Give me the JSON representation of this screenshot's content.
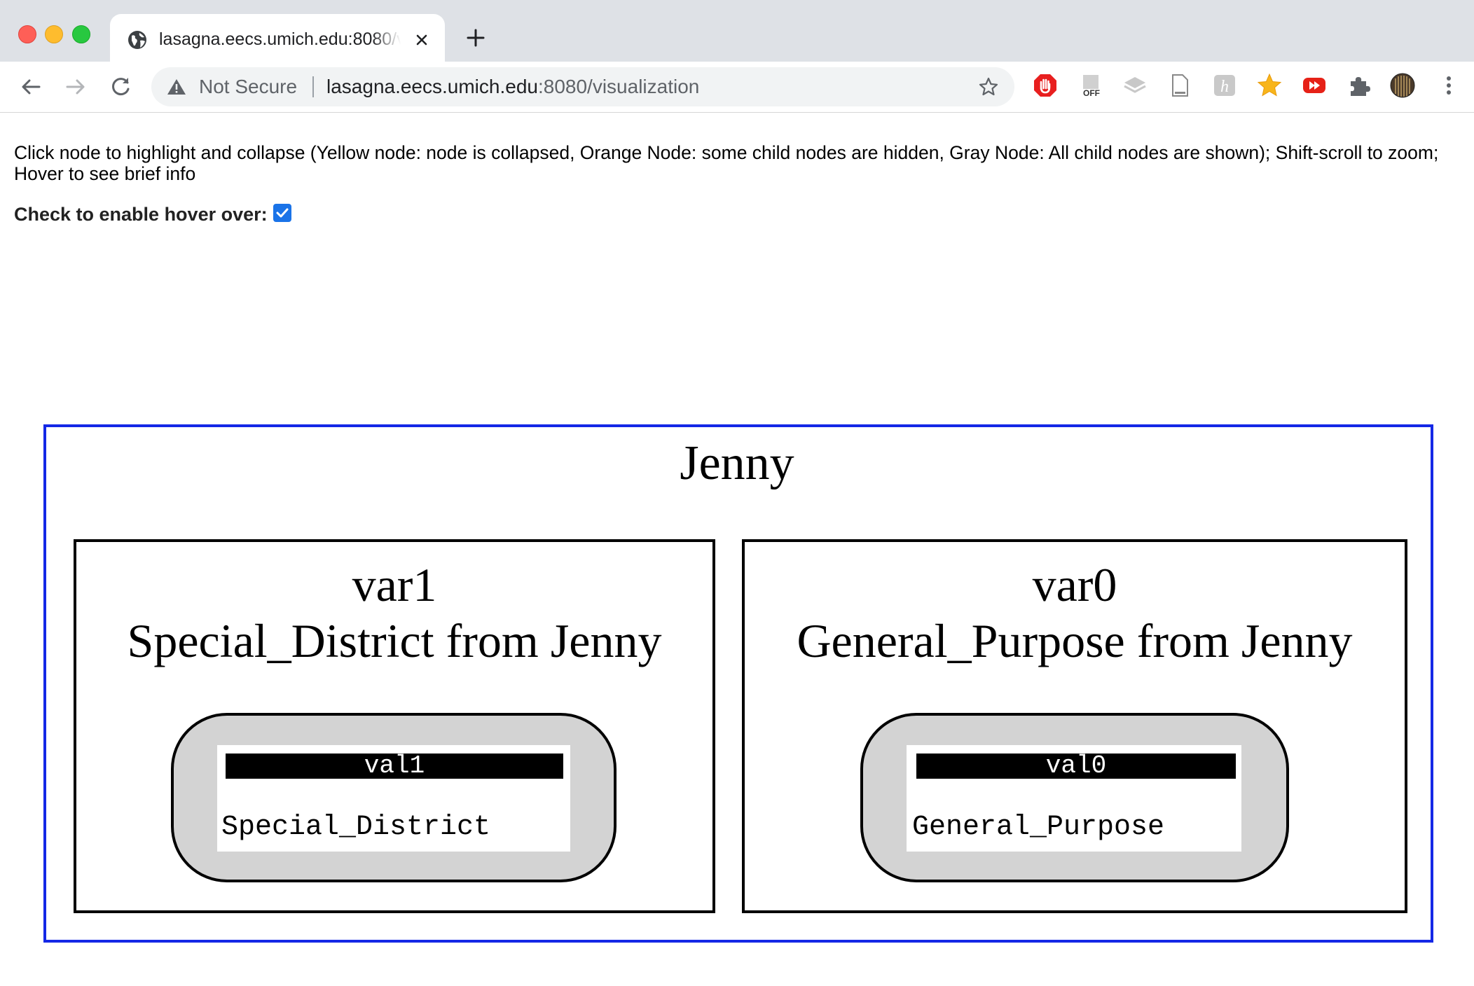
{
  "browser": {
    "tab_title": "lasagna.eecs.umich.edu:8080/visualization",
    "security_label": "Not Secure",
    "url_host": "lasagna.eecs.umich.edu",
    "url_rest": ":8080/visualization",
    "extensions": [
      "adblock-icon",
      "off-toggle-icon",
      "layers-icon",
      "document-icon",
      "h-extension-icon",
      "star-extension-icon",
      "youtube-icon",
      "puzzle-icon",
      "profile-avatar"
    ]
  },
  "page": {
    "instructions": "Click node to highlight and collapse (Yellow node: node is collapsed, Orange Node: some child nodes are hidden, Gray Node: All child nodes are shown); Shift-scroll to zoom; Hover to see brief info",
    "hover_label": "Check to enable hover over:",
    "hover_checked": true
  },
  "graph": {
    "root": "Jenny",
    "clusters": [
      {
        "name": "var1",
        "description": "Special_District from Jenny",
        "node": {
          "label": "val1",
          "value": "Special_District",
          "state": "gray"
        }
      },
      {
        "name": "var0",
        "description": "General_Purpose from Jenny",
        "node": {
          "label": "val0",
          "value": "General_Purpose",
          "state": "gray"
        }
      }
    ]
  },
  "colors": {
    "outer_cluster_border": "#1428e6",
    "node_fill": "#d3d3d3",
    "checkbox": "#1a73e8"
  }
}
